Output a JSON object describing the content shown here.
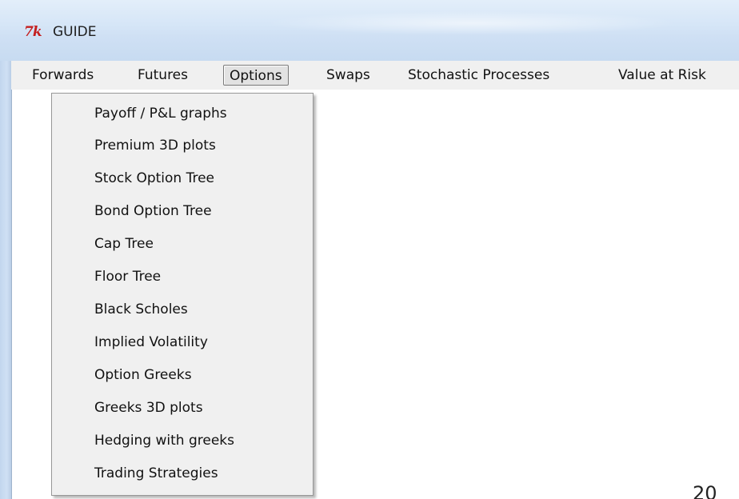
{
  "window": {
    "icon_label": "7k",
    "title": "GUIDE"
  },
  "menubar": {
    "items": [
      {
        "label": "Forwards"
      },
      {
        "label": "Futures"
      },
      {
        "label": "Options"
      },
      {
        "label": "Swaps"
      },
      {
        "label": "Stochastic Processes"
      },
      {
        "label": "Value at Risk"
      }
    ],
    "active": "Options"
  },
  "dropdown": {
    "items": [
      {
        "label": "Payoff / P&L graphs"
      },
      {
        "label": "Premium 3D plots"
      },
      {
        "label": "Stock Option Tree"
      },
      {
        "label": "Bond Option Tree"
      },
      {
        "label": "Cap Tree"
      },
      {
        "label": "Floor Tree"
      },
      {
        "label": "Black Scholes"
      },
      {
        "label": "Implied Volatility"
      },
      {
        "label": "Option Greeks"
      },
      {
        "label": "Greeks 3D plots"
      },
      {
        "label": "Hedging with greeks"
      },
      {
        "label": "Trading Strategies"
      }
    ]
  },
  "client": {
    "corner_text": "20"
  },
  "colors": {
    "titlebar": "#d6e6f7",
    "icon": "#c41f1f",
    "menu_bg": "#f0f0f0"
  }
}
